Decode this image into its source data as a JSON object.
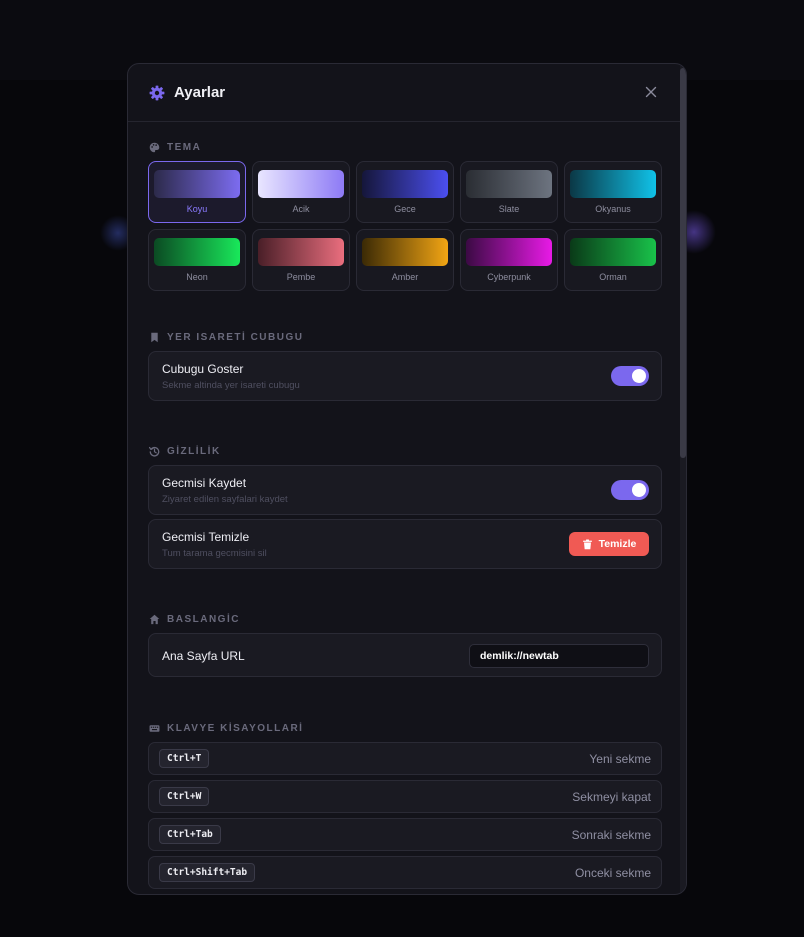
{
  "header": {
    "title": "Ayarlar"
  },
  "sections": {
    "theme": "TEMA",
    "bookmarks": "YER ISARETİ CUBUGU",
    "privacy": "GİZLİLİK",
    "startup": "BASLANGİC",
    "shortcuts": "KLAVYE KİSAYOLLARİ"
  },
  "themes": [
    {
      "label": "Koyu",
      "active": true,
      "from": "#2c2a4a",
      "to": "#7c6cf0"
    },
    {
      "label": "Acik",
      "active": false,
      "from": "#e9e6ff",
      "to": "#8d7af5"
    },
    {
      "label": "Gece",
      "active": false,
      "from": "#15163a",
      "to": "#4b4ff0"
    },
    {
      "label": "Slate",
      "active": false,
      "from": "#2a2d33",
      "to": "#6d7480"
    },
    {
      "label": "Okyanus",
      "active": false,
      "from": "#0b3846",
      "to": "#10c2e8"
    },
    {
      "label": "Neon",
      "active": false,
      "from": "#0b4a23",
      "to": "#19e85a"
    },
    {
      "label": "Pembe",
      "active": false,
      "from": "#4a1f28",
      "to": "#ea6e7e"
    },
    {
      "label": "Amber",
      "active": false,
      "from": "#3b2a05",
      "to": "#f2a514"
    },
    {
      "label": "Cyberpunk",
      "active": false,
      "from": "#3b0a44",
      "to": "#e81ae6"
    },
    {
      "label": "Orman",
      "active": false,
      "from": "#0a3a18",
      "to": "#19c24a"
    }
  ],
  "bookmarks": {
    "show_title": "Cubugu Goster",
    "show_sub": "Sekme altinda yer isareti cubugu",
    "show_on": true
  },
  "privacy": {
    "save_title": "Gecmisi Kaydet",
    "save_sub": "Ziyaret edilen sayfalari kaydet",
    "save_on": true,
    "clear_title": "Gecmisi Temizle",
    "clear_sub": "Tum tarama gecmisini sil",
    "clear_button": "Temizle"
  },
  "startup": {
    "home_label": "Ana Sayfa URL",
    "home_value": "demlik://newtab"
  },
  "shortcuts": [
    {
      "keys": "Ctrl+T",
      "desc": "Yeni sekme"
    },
    {
      "keys": "Ctrl+W",
      "desc": "Sekmeyi kapat"
    },
    {
      "keys": "Ctrl+Tab",
      "desc": "Sonraki sekme"
    },
    {
      "keys": "Ctrl+Shift+Tab",
      "desc": "Onceki sekme"
    }
  ],
  "colors": {
    "accent": "#7b68ee",
    "danger": "#f05a54"
  }
}
